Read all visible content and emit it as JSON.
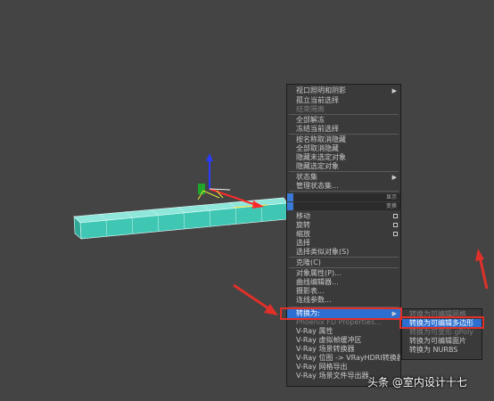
{
  "context_menu": {
    "items": [
      {
        "label": "视口照明和阴影",
        "type": "arrow",
        "dim": false
      },
      {
        "label": "孤立当前选择",
        "dim": false
      },
      {
        "label": "结束隔离",
        "dim": true
      },
      {
        "label": "全部解冻",
        "dim": false
      },
      {
        "label": "冻结当前选择",
        "dim": false
      },
      {
        "label": "按名称取消隐藏",
        "dim": false
      },
      {
        "label": "全部取消隐藏",
        "dim": false
      },
      {
        "label": "隐藏未选定对象",
        "dim": false
      },
      {
        "label": "隐藏选定对象",
        "dim": false
      },
      {
        "label": "状态集",
        "type": "arrow",
        "dim": false
      },
      {
        "label": "管理状态集...",
        "dim": false
      },
      {
        "label": "移动",
        "type": "box",
        "dim": false
      },
      {
        "label": "旋转",
        "type": "box",
        "dim": false
      },
      {
        "label": "缩放",
        "type": "box",
        "dim": false
      },
      {
        "label": "选择",
        "dim": false
      },
      {
        "label": "选择类似对象(S)",
        "dim": false
      },
      {
        "label": "克隆(C)",
        "dim": false
      },
      {
        "label": "对象属性(P)...",
        "dim": false
      },
      {
        "label": "曲线编辑器...",
        "dim": false
      },
      {
        "label": "摄影表...",
        "dim": false
      },
      {
        "label": "连线参数...",
        "dim": false
      },
      {
        "label": "转换为:",
        "type": "arrow",
        "dim": false,
        "highlight": true
      },
      {
        "label": "Phoenix FD Properties...",
        "dim": true
      },
      {
        "label": "V-Ray 属性",
        "dim": false
      },
      {
        "label": "V-Ray 虚拟帧缓冲区",
        "dim": false
      },
      {
        "label": "V-Ray 场景转换器",
        "dim": false
      },
      {
        "label": "V-Ray 位图 -> VRayHDRI转换器",
        "dim": false
      },
      {
        "label": "V-Ray 网格导出",
        "dim": false
      },
      {
        "label": "V-Ray 场景文件导出器",
        "dim": false
      }
    ],
    "quad_labels": [
      "显示",
      "变换"
    ]
  },
  "convert_submenu": {
    "items": [
      {
        "label": "转换为可编辑网格",
        "dim": true
      },
      {
        "label": "转换为可编辑多边形",
        "highlight": true
      },
      {
        "label": "转换为可变形 gPoly",
        "dim": true
      },
      {
        "label": "转换为可编辑面片",
        "dim": false
      },
      {
        "label": "转换为 NURBS",
        "dim": false
      }
    ]
  },
  "watermark": "头条 @室内设计十七",
  "colors": {
    "viewport_bg": "#444444",
    "menu_bg": "#3a3a3a",
    "highlight": "#2d6fd0",
    "annotation_red": "#e0302a",
    "box_fill": "#4fd1bf"
  }
}
